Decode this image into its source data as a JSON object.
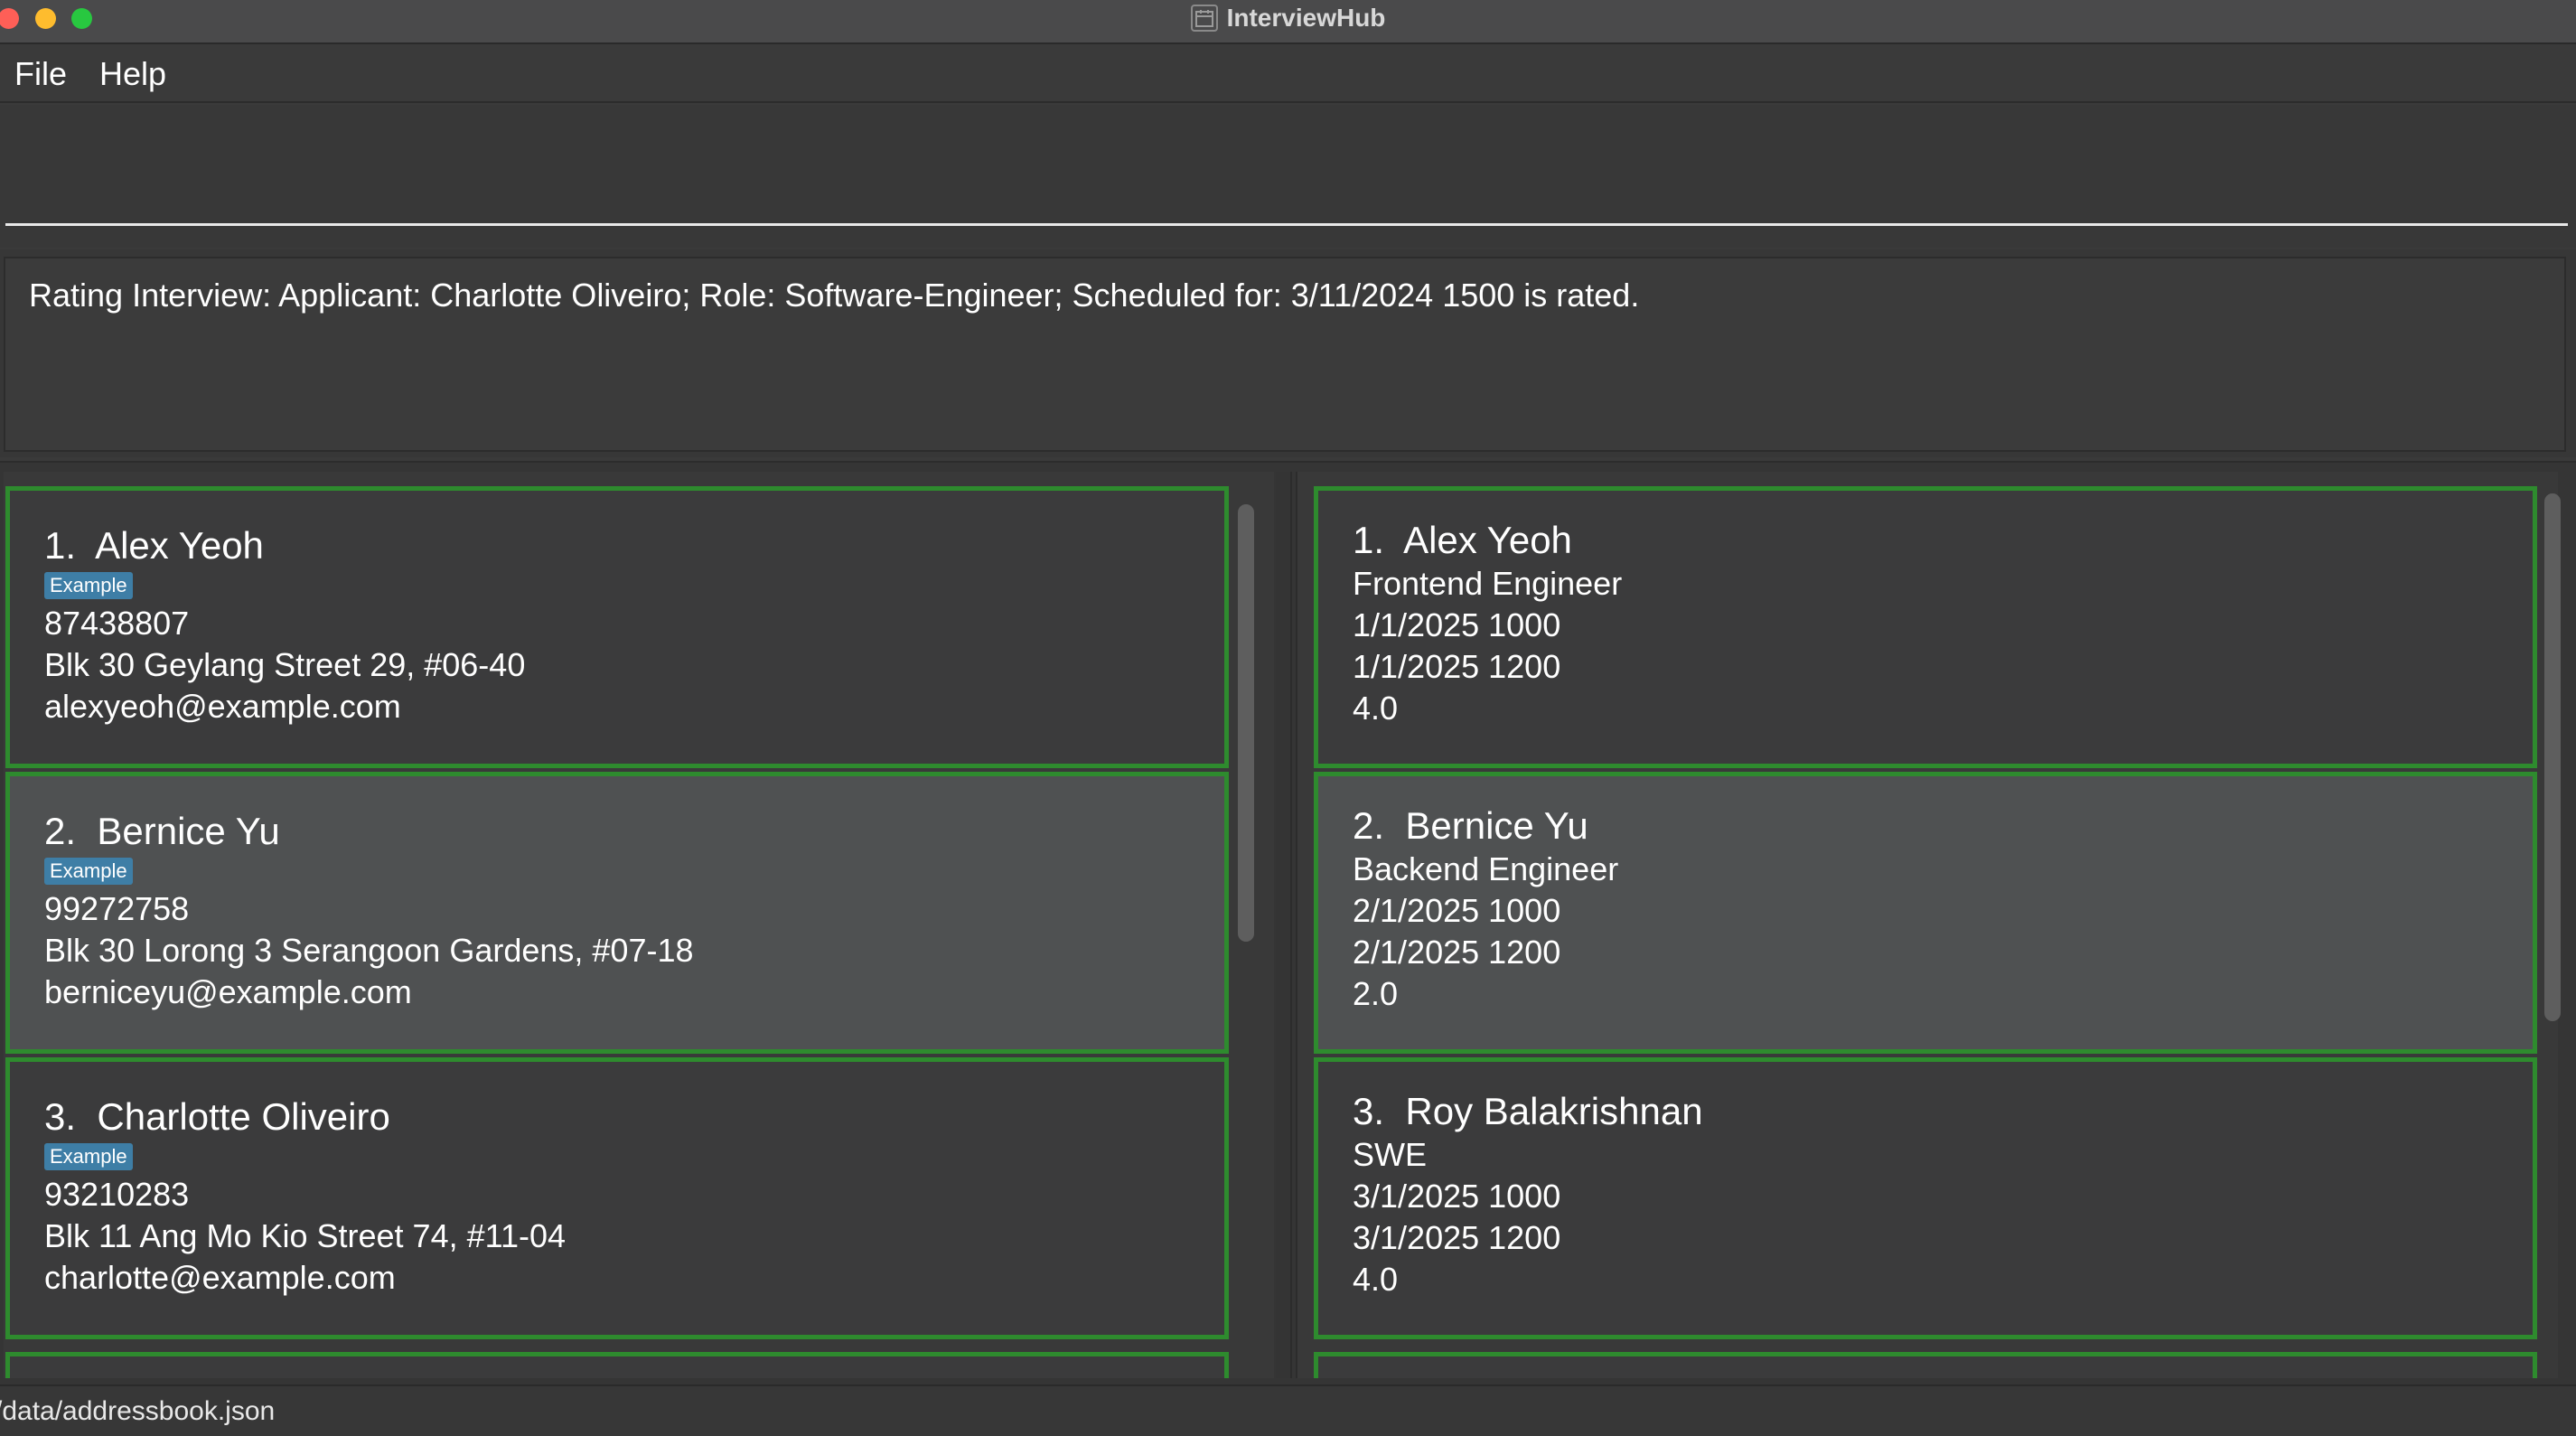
{
  "window": {
    "title": "InterviewHub",
    "app_icon": "calendar-icon"
  },
  "menu": {
    "items": [
      "File",
      "Help"
    ]
  },
  "command": {
    "value": "",
    "placeholder": ""
  },
  "result": {
    "message": "Rating Interview: Applicant: Charlotte Oliveiro; Role: Software-Engineer; Scheduled for: 3/11/2024 1500 is rated."
  },
  "persons": [
    {
      "index": "1.",
      "name": "Alex Yeoh",
      "tag": "Example",
      "phone": "87438807",
      "address": "Blk 30 Geylang Street 29, #06-40",
      "email": "alexyeoh@example.com"
    },
    {
      "index": "2.",
      "name": "Bernice Yu",
      "tag": "Example",
      "phone": "99272758",
      "address": "Blk 30 Lorong 3 Serangoon Gardens, #07-18",
      "email": "berniceyu@example.com"
    },
    {
      "index": "3.",
      "name": "Charlotte Oliveiro",
      "tag": "Example",
      "phone": "93210283",
      "address": "Blk 11 Ang Mo Kio Street 74, #11-04",
      "email": "charlotte@example.com"
    }
  ],
  "interviews": [
    {
      "index": "1.",
      "name": "Alex Yeoh",
      "role": "Frontend Engineer",
      "start": "1/1/2025 1000",
      "end": "1/1/2025 1200",
      "rating": "4.0"
    },
    {
      "index": "2.",
      "name": "Bernice Yu",
      "role": "Backend Engineer",
      "start": "2/1/2025 1000",
      "end": "2/1/2025 1200",
      "rating": "2.0"
    },
    {
      "index": "3.",
      "name": "Roy Balakrishnan",
      "role": "SWE",
      "start": "3/1/2025 1000",
      "end": "3/1/2025 1200",
      "rating": "4.0"
    }
  ],
  "status": {
    "path": "/data/addressbook.json"
  },
  "colors": {
    "card_border": "#2e8b2e",
    "tag_bg": "#3e7ea6",
    "selected_card_bg": "#4f5152"
  }
}
